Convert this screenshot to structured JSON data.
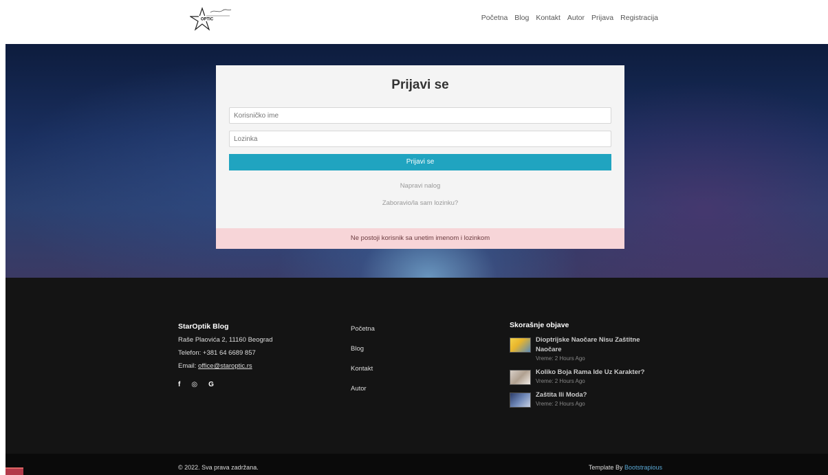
{
  "header": {
    "logo_alt": "OPTIC",
    "nav": [
      "Početna",
      "Blog",
      "Kontakt",
      "Autor",
      "Prijava",
      "Registracija"
    ]
  },
  "login": {
    "title": "Prijavi se",
    "username_placeholder": "Korisničko ime",
    "password_placeholder": "Lozinka",
    "submit_label": "Prijavi se",
    "register_link": "Napravi nalog",
    "forgot_link": "Zaboravio/la sam lozinku?",
    "error_message": "Ne postoji korisnik sa unetim imenom i lozinkom"
  },
  "footer": {
    "brand": "StarOptik Blog",
    "address": "Raše Plaovića 2, 11160 Beograd",
    "phone": "Telefon: +381 64 6689 857",
    "email_prefix": "Email: ",
    "email": "office@staroptic.rs",
    "socials": [
      "f",
      "◎",
      "G"
    ],
    "links": [
      "Početna",
      "Blog",
      "Kontakt",
      "Autor"
    ],
    "recent_title": "Skorašnje objave",
    "recent_posts": [
      {
        "title": "Dioptrijske Naočare Nisu Zaštitne Naočare",
        "time": "Vreme: 2 Hours Ago"
      },
      {
        "title": "Koliko Boja Rama Ide Uz Karakter?",
        "time": "Vreme: 2 Hours Ago"
      },
      {
        "title": "Zaštita Ili Moda?",
        "time": "Vreme: 2 Hours Ago"
      }
    ],
    "copyright": "© 2022. Sva prava zadržana.",
    "template_by": "Template By ",
    "template_author": "Bootstrapious"
  },
  "colors": {
    "accent": "#20a4c0",
    "error_bg": "#f7d5d8",
    "footer_bg": "#141414"
  }
}
